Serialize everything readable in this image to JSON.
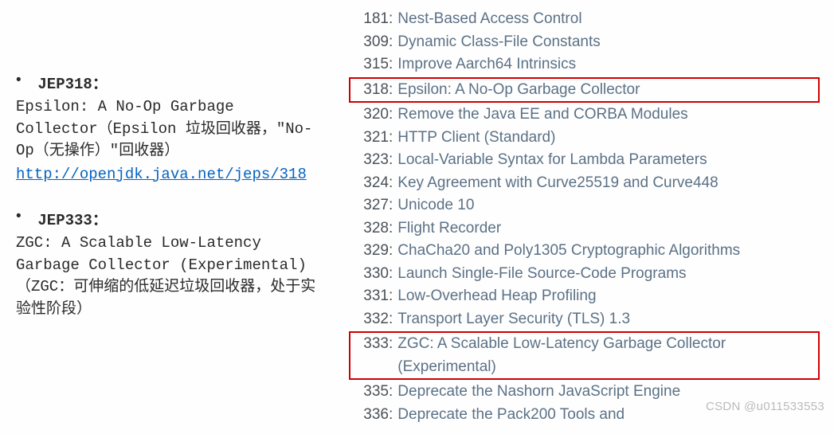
{
  "left": {
    "blocks": [
      {
        "label": "JEP318：",
        "desc": "Epsilon: A No-Op Garbage Collector（Epsilon 垃圾回收器，\"No-Op（无操作）\"回收器）",
        "link_text": "http://openjdk.java.net/jeps/318"
      },
      {
        "label": "JEP333：",
        "desc": "ZGC: A Scalable Low-Latency Garbage Collector (Experimental)（ZGC：可伸缩的低延迟垃圾回收器，处于实验性阶段）",
        "link_text": ""
      }
    ]
  },
  "jeps": [
    {
      "num": "181",
      "title": "Nest-Based Access Control",
      "hl": false
    },
    {
      "num": "309",
      "title": "Dynamic Class-File Constants",
      "hl": false
    },
    {
      "num": "315",
      "title": "Improve Aarch64 Intrinsics",
      "hl": false
    },
    {
      "num": "318",
      "title": "Epsilon: A No-Op Garbage Collector",
      "hl": true
    },
    {
      "num": "320",
      "title": "Remove the Java EE and CORBA Modules",
      "hl": false
    },
    {
      "num": "321",
      "title": "HTTP Client (Standard)",
      "hl": false
    },
    {
      "num": "323",
      "title": "Local-Variable Syntax for Lambda Parameters",
      "hl": false
    },
    {
      "num": "324",
      "title": "Key Agreement with Curve25519 and Curve448",
      "hl": false
    },
    {
      "num": "327",
      "title": "Unicode 10",
      "hl": false
    },
    {
      "num": "328",
      "title": "Flight Recorder",
      "hl": false
    },
    {
      "num": "329",
      "title": "ChaCha20 and Poly1305 Cryptographic Algorithms",
      "hl": false
    },
    {
      "num": "330",
      "title": "Launch Single-File Source-Code Programs",
      "hl": false
    },
    {
      "num": "331",
      "title": "Low-Overhead Heap Profiling",
      "hl": false
    },
    {
      "num": "332",
      "title": "Transport Layer Security (TLS) 1.3",
      "hl": false
    },
    {
      "num": "333",
      "title": "ZGC: A Scalable Low-Latency Garbage Collector (Experimental)",
      "hl": true
    },
    {
      "num": "335",
      "title": "Deprecate the Nashorn JavaScript Engine",
      "hl": false
    },
    {
      "num": "336",
      "title": "Deprecate the Pack200 Tools and",
      "hl": false
    }
  ],
  "watermark": "CSDN @u011533553"
}
